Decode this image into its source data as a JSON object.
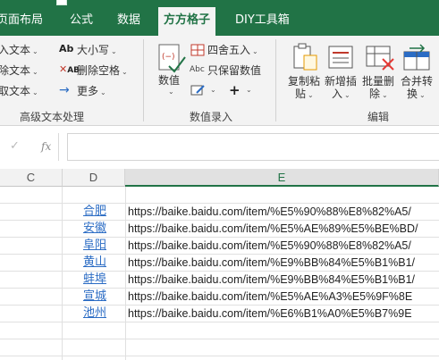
{
  "tabs": [
    "页面布局",
    "公式",
    "数据",
    "方方格子",
    "DIY工具箱"
  ],
  "active_tab": "方方格子",
  "ribbon": {
    "text_group": {
      "items": [
        "入文本",
        "除文本",
        "取文本"
      ],
      "label": "高级文本处理"
    },
    "case_group": {
      "upper_lower": "大小写",
      "delete_spaces": "删除空格",
      "more": "更多"
    },
    "number_group": {
      "numeric": "数值",
      "round": "四舍五入",
      "keep_numbers": "只保留数值",
      "label": "数值录入"
    },
    "edit_group": {
      "copy_paste_1": "复制粘",
      "copy_paste_2": "贴",
      "insert_1": "新增插",
      "insert_2": "入",
      "batch_delete_1": "批量删",
      "batch_delete_2": "除",
      "merge_1": "合并转",
      "merge_2": "换",
      "label": "编辑"
    }
  },
  "formula_bar": {
    "cancel_glyph": "✓",
    "fx_glyph": "fx",
    "value": ""
  },
  "columns": [
    "C",
    "D",
    "E"
  ],
  "rows": [
    {
      "city": "合肥",
      "url": "https://baike.baidu.com/item/%E5%90%88%E8%82%A5/"
    },
    {
      "city": "安徽",
      "url": "https://baike.baidu.com/item/%E5%AE%89%E5%BE%BD/"
    },
    {
      "city": "阜阳",
      "url": "https://baike.baidu.com/item/%E5%90%88%E8%82%A5/"
    },
    {
      "city": "黄山",
      "url": "https://baike.baidu.com/item/%E9%BB%84%E5%B1%B1/"
    },
    {
      "city": "蚌埠",
      "url": "https://baike.baidu.com/item/%E9%BB%84%E5%B1%B1/"
    },
    {
      "city": "宣城",
      "url": "https://baike.baidu.com/item/%E5%AE%A3%E5%9F%8E"
    },
    {
      "city": "池州",
      "url": "https://baike.baidu.com/item/%E6%B1%A0%E5%B7%9E"
    }
  ],
  "colors": {
    "accent": "#217346",
    "hyperlink": "#2b6cc4",
    "ribbon_bg": "#f3f3f3"
  }
}
